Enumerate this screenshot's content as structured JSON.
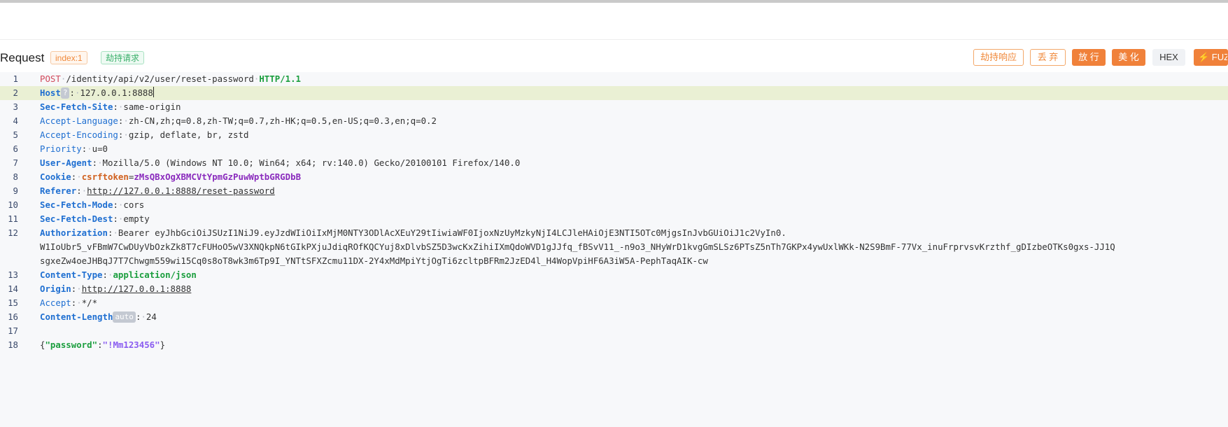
{
  "header": {
    "title": "Request",
    "index_tag": "index:1",
    "hijack_tag": "劫持请求"
  },
  "toolbar": {
    "hijack_response": "劫持响应",
    "discard": "丢 弃",
    "forward": "放 行",
    "beautify": "美 化",
    "hex": "HEX",
    "fuzz": "⚡ FUZ"
  },
  "editor": {
    "line_numbers": [
      "1",
      "2",
      "3",
      "4",
      "5",
      "6",
      "7",
      "8",
      "9",
      "10",
      "11",
      "12",
      "13",
      "14",
      "15",
      "16",
      "17",
      "18"
    ],
    "request_line": {
      "method": "POST",
      "path": "/identity/api/v2/user/reset-password",
      "version": "HTTP/1.1"
    },
    "headers": {
      "host": {
        "name": "Host",
        "badge": "?",
        "value": "127.0.0.1:8888"
      },
      "sec_fetch_site": {
        "name": "Sec-Fetch-Site",
        "value": "same-origin"
      },
      "accept_language": {
        "name": "Accept-Language",
        "value": "zh-CN,zh;q=0.8,zh-TW;q=0.7,zh-HK;q=0.5,en-US;q=0.3,en;q=0.2"
      },
      "accept_encoding": {
        "name": "Accept-Encoding",
        "value": "gzip, deflate, br, zstd"
      },
      "priority": {
        "name": "Priority",
        "value": "u=0"
      },
      "user_agent": {
        "name": "User-Agent",
        "value": "Mozilla/5.0 (Windows NT 10.0; Win64; x64; rv:140.0) Gecko/20100101 Firefox/140.0"
      },
      "cookie": {
        "name": "Cookie",
        "cookie_name": "csrftoken",
        "eq": "=",
        "cookie_value": "zMsQBxOgXBMCVtYpmGzPuwWptbGRGDbB"
      },
      "referer": {
        "name": "Referer",
        "value": "http://127.0.0.1:8888/reset-password"
      },
      "sec_fetch_mode": {
        "name": "Sec-Fetch-Mode",
        "value": "cors"
      },
      "sec_fetch_dest": {
        "name": "Sec-Fetch-Dest",
        "value": "empty"
      },
      "authorization": {
        "name": "Authorization",
        "value_line1": "Bearer eyJhbGciOiJSUzI1NiJ9.eyJzdWIiOiIxMjM0NTY3ODlAcXEuY29tIiwiaWF0IjoxNzUyMzkyNjI4LCJleHAiOjE3NTI5OTc0MjgsInJvbGUiOiJ1c2VyIn0.",
        "value_line2": "W1IoUbr5_vFBmW7CwDUyVbOzkZk8T7cFUHoO5wV3XNQkpN6tGIkPXjuJdiqROfKQCYuj8xDlvbSZ5D3wcKxZihiIXmQdoWVD1gJJfq_fBSvV11_-n9o3_NHyWrD1kvgGmSLSz6PTsZ5nTh7GKPx4ywUxlWKk-N2S9BmF-77Vx_inuFrprvsvKrzthf_gDIzbeOTKs0gxs-JJ1Q",
        "value_line3": "sgxeZw4oeJHBqJ7T7Chwgm559wi15Cq0s8oT8wk3m6Tp9I_YNTtSFXZcmu11DX-2Y4xMdMpiYtjOgTi6zcltpBFRm2JzED4l_H4WopVpiHF6A3iW5A-PephTaqAIK-cw"
      },
      "content_type": {
        "name": "Content-Type",
        "value": "application/json"
      },
      "origin": {
        "name": "Origin",
        "value": "http://127.0.0.1:8888"
      },
      "accept": {
        "name": "Accept",
        "value": "*/*"
      },
      "content_length": {
        "name": "Content-Length",
        "badge": "auto",
        "value": "24"
      }
    },
    "body": {
      "key": "\"password\"",
      "value": "\"!Mm123456\""
    }
  },
  "colors": {
    "accent": "#f0813a",
    "method": "#d1495b",
    "header_key": "#1f6fd1",
    "json_key": "#1b9e3e",
    "json_string": "#8a5cf0",
    "cookie_name": "#d0601e",
    "cookie_value": "#8a2bbd",
    "highlight_line": "#eaf0d4"
  }
}
